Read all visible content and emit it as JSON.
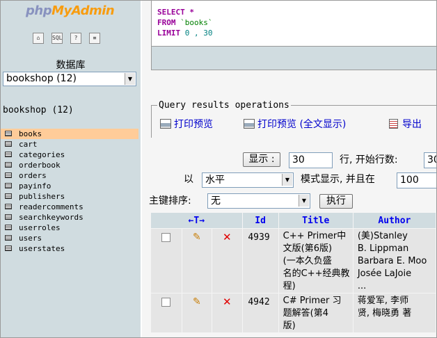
{
  "nav": {
    "logo_php": "php",
    "logo_rest": "MyAdmin",
    "icons": [
      "home-icon",
      "sql-icon",
      "help-icon",
      "docs-icon"
    ],
    "database_label": "数据库",
    "database_select": "bookshop (12)",
    "database_heading": "bookshop (12)",
    "tables": [
      "books",
      "cart",
      "categories",
      "orderbook",
      "orders",
      "payinfo",
      "publishers",
      "readercomments",
      "searchkeywords",
      "userroles",
      "users",
      "userstates"
    ],
    "active_table": "books"
  },
  "sql": {
    "kw_select": "SELECT",
    "star": "*",
    "kw_from": "FROM",
    "table": "`books`",
    "kw_limit": "LIMIT",
    "offset": "0",
    "sep": ",",
    "count": "30"
  },
  "ops": {
    "legend": "Query results operations",
    "print_view": "打印预览",
    "print_full": "打印预览 (全文显示)",
    "export": "导出"
  },
  "nav_form": {
    "show_button": "显示 :",
    "rows_value": "30",
    "rows_label": "行, 开始行数:",
    "start_value": "30",
    "with_label": "以",
    "mode_select": "水平",
    "mode_label": "模式显示, 并且在",
    "repeat_value": "100"
  },
  "sort_form": {
    "label": "主键排序:",
    "select": "无",
    "go_button": "执行"
  },
  "table": {
    "headers": {
      "arrows": "←T→",
      "id": "Id",
      "title": "Title",
      "author": "Author"
    },
    "rows": [
      {
        "id": "4939",
        "title_lines": [
          "C++ Primer中",
          "文版(第6版)",
          "(一本久负盛",
          "名的C++经典教",
          "程)"
        ],
        "author_lines": [
          "(美)Stanley",
          "B. Lippman",
          "Barbara E. Moo",
          "Josée LaJoie",
          "..."
        ]
      },
      {
        "id": "4942",
        "title_lines": [
          "C# Primer 习",
          "题解答(第4",
          "版)"
        ],
        "author_lines": [
          "蒋爱军, 李师",
          "贤, 梅晓勇  著"
        ]
      }
    ]
  },
  "colors": {
    "nav_bg": "#d0dce0",
    "active_row": "#ffcc99",
    "link": "#0000cc",
    "keyword": "#990099"
  }
}
